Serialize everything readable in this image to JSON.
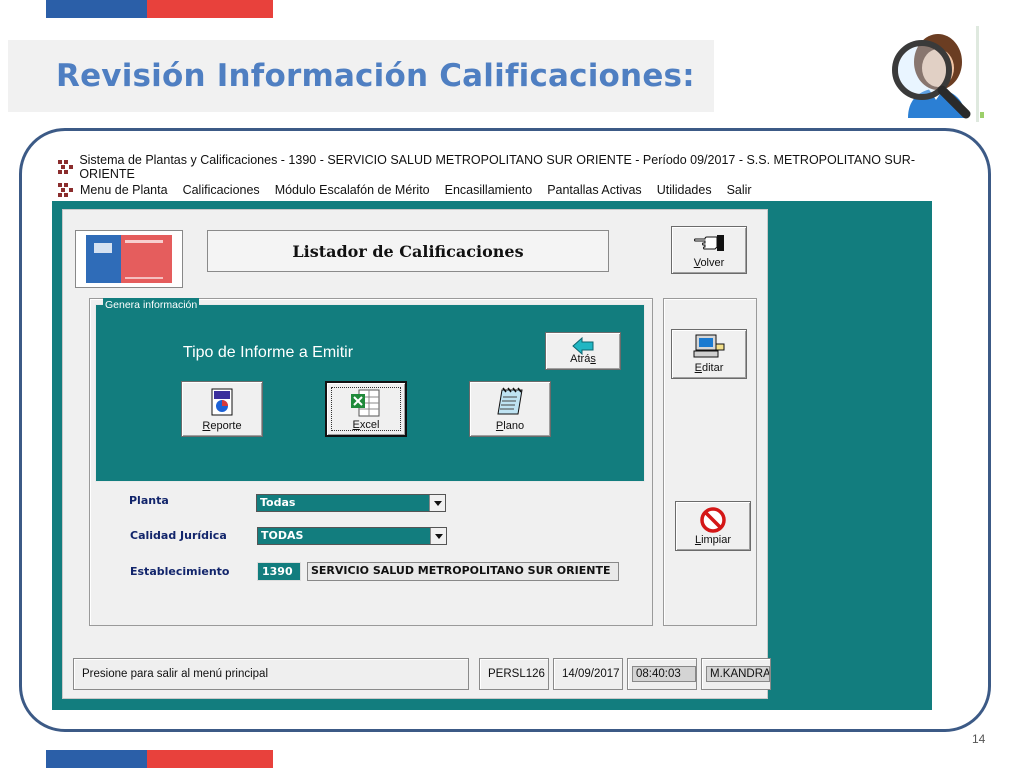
{
  "slide": {
    "title": "Revisión Información Calificaciones:",
    "page_number": "14",
    "colors": {
      "blue": "#2b5fa8",
      "red": "#e8413c",
      "title": "#4f7fc2",
      "frame": "#3c5a86"
    },
    "decor_icon": "user-magnifier-icon"
  },
  "app": {
    "title": "Sistema de Plantas y Calificaciones - 1390 - SERVICIO SALUD METROPOLITANO SUR ORIENTE - Período 09/2017 - S.S. METROPOLITANO SUR-ORIENTE",
    "menu": [
      "Menu de Planta",
      "Calificaciones",
      "Módulo Escalafón de Mérito",
      "Encasillamiento",
      "Pantallas Activas",
      "Utilidades",
      "Salir"
    ],
    "accent": "#127d7e",
    "form": {
      "title": "Listador de Calificaciones",
      "logo_icon": "ministerio-logo",
      "buttons": {
        "volver": {
          "prefix": "",
          "underlined": "V",
          "rest": "olver",
          "icon": "pointing-hand-icon"
        },
        "editar": {
          "prefix": "",
          "underlined": "E",
          "rest": "ditar",
          "icon": "computer-icon"
        },
        "limpiar": {
          "prefix": "",
          "underlined": "L",
          "rest": "impiar",
          "icon": "no-entry-icon"
        }
      },
      "group": {
        "label": "Genera información",
        "heading": "Tipo de Informe a Emitir",
        "atras": {
          "prefix": "Atrá",
          "underlined": "s",
          "rest": "",
          "icon": "left-arrow-icon"
        },
        "reporte": {
          "prefix": "",
          "underlined": "R",
          "rest": "eporte",
          "icon": "report-icon"
        },
        "excel": {
          "prefix": "",
          "underlined": "E",
          "rest": "xcel",
          "icon": "excel-icon"
        },
        "plano": {
          "prefix": "",
          "underlined": "P",
          "rest": "lano",
          "icon": "notepad-icon"
        }
      },
      "fields": {
        "planta": {
          "label": "Planta",
          "value": "Todas"
        },
        "calidad": {
          "label": "Calidad Jurídica",
          "value": "TODAS"
        },
        "establecimiento": {
          "label": "Establecimiento",
          "code": "1390",
          "name": "SERVICIO SALUD METROPOLITANO SUR ORIENTE"
        }
      }
    },
    "status": {
      "message": "Presione para salir al menú principal",
      "user": "PERSL126",
      "date": "14/09/2017",
      "time": "08:40:03",
      "operator": "M.KANDRAD"
    }
  }
}
